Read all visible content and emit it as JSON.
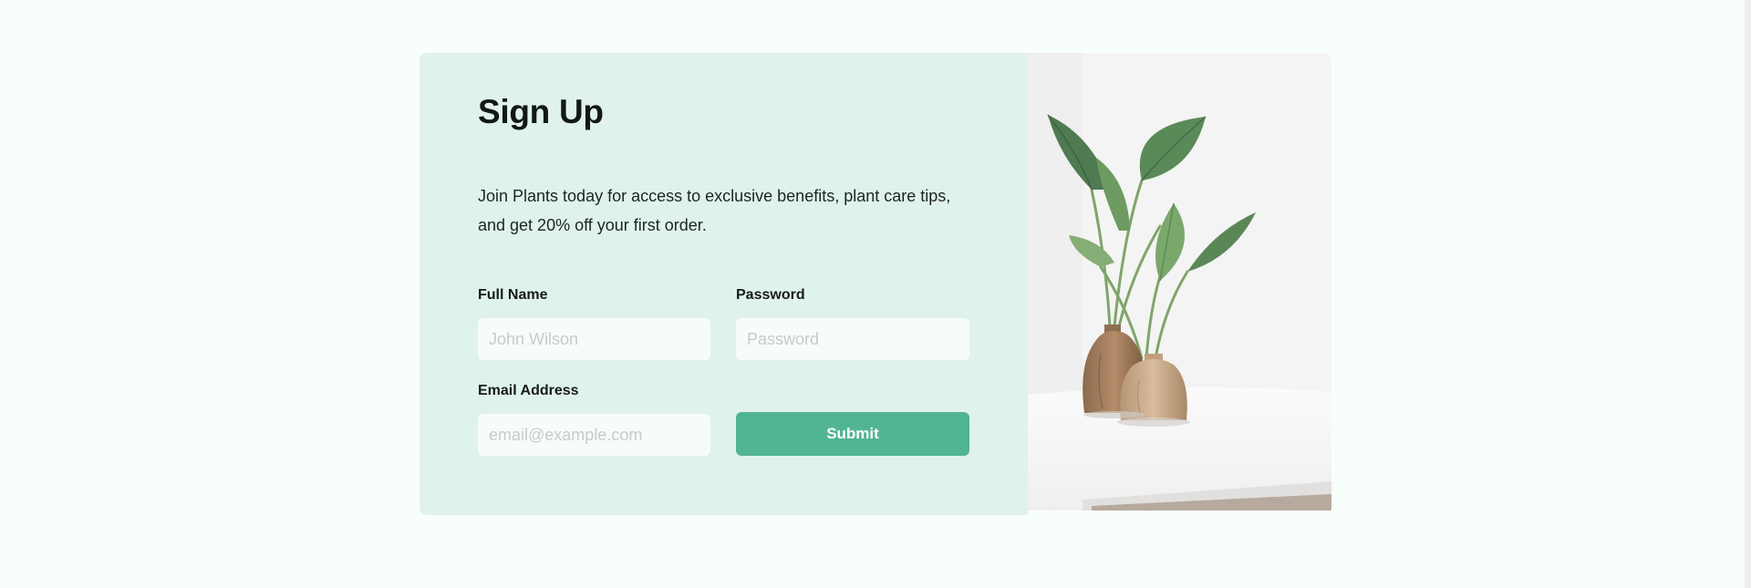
{
  "signup": {
    "title": "Sign Up",
    "description": "Join Plants today for access to exclusive benefits, plant care tips, and get 20% off your first order.",
    "full_name": {
      "label": "Full Name",
      "placeholder": "John Wilson",
      "value": ""
    },
    "password": {
      "label": "Password",
      "placeholder": "Password",
      "value": ""
    },
    "email": {
      "label": "Email Address",
      "placeholder": "email@example.com",
      "value": ""
    },
    "submit_label": "Submit"
  },
  "colors": {
    "page_background": "#f8fffb",
    "form_panel": "#e0f2ec",
    "input_background": "#f7fcfa",
    "submit_button": "#52b591",
    "submit_text": "#ffffff",
    "heading_text": "#121815"
  },
  "image": {
    "subject": "potted-plants-photo"
  }
}
